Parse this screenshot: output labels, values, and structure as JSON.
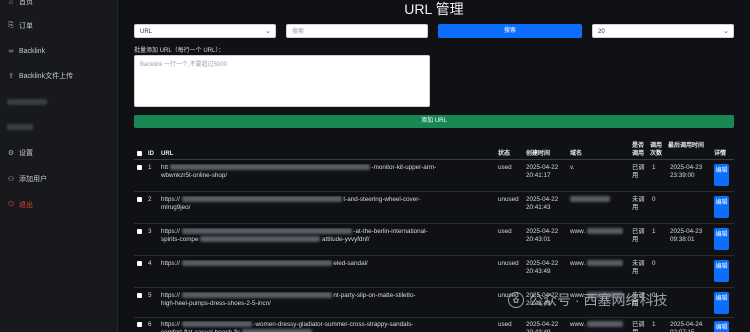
{
  "sidebar": {
    "items": [
      {
        "label": "首页",
        "icon": "home-icon",
        "glyph": "⌂"
      },
      {
        "label": "订单",
        "icon": "order-icon",
        "glyph": "⎘"
      },
      {
        "label": "Backlink",
        "icon": "link-icon",
        "glyph": "∞"
      },
      {
        "label": "Backlink文件上传",
        "icon": "upload-icon",
        "glyph": "⇪"
      },
      {
        "label": "设置",
        "icon": "gear-icon",
        "glyph": "⚙"
      },
      {
        "label": "添加用户",
        "icon": "user-add-icon",
        "glyph": "⚇"
      },
      {
        "label": "退出",
        "icon": "logout-icon",
        "glyph": "⏻"
      }
    ]
  },
  "header": {
    "title": "URL 管理"
  },
  "filters": {
    "field_select": "URL",
    "search_placeholder": "搜索",
    "search_button": "搜索",
    "page_size": "20"
  },
  "batch": {
    "label": "批量添加 URL（每行一个 URL）：",
    "placeholder": "Backlink 一行一个,不要超过5000",
    "add_button": "添加 URL"
  },
  "table": {
    "headers": {
      "id": "ID",
      "url": "URL",
      "status": "状态",
      "created": "创建时间",
      "domain": "域名",
      "called": "是否调用",
      "count": "调用次数",
      "last_called": "最后调用时间",
      "detail": "详情"
    },
    "rows": [
      {
        "id": "1",
        "url1": "htt",
        "url1b": "-monitor-kit-upper-arm-",
        "url2": "wbwnkzr5t-online-shop/",
        "status": "used",
        "created": "2025-04-22 20:41:17",
        "domain": "v.",
        "called": "已调用",
        "count": "1",
        "last": "2025-04-23 23:39:00",
        "edit": "编辑"
      },
      {
        "id": "2",
        "url1": "https://",
        "url1b": "t-and-steering-wheel-cover-",
        "url2": "mlrug9jeo/",
        "status": "unused",
        "created": "2025-04-22 20:41:43",
        "domain": "",
        "called": "未调用",
        "count": "0",
        "last": "",
        "edit": "编辑"
      },
      {
        "id": "3",
        "url1": "https://",
        "url1b": "-at-the-berlin-international-",
        "url2": "spirits-compe",
        "url2b": "attitude-yvvyfdnf/",
        "status": "used",
        "created": "2025-04-22 20:43:01",
        "domain": "www.",
        "called": "已调用",
        "count": "1",
        "last": "2025-04-23 09:38:01",
        "edit": "编辑"
      },
      {
        "id": "4",
        "url1": "https://",
        "url1b": "eled-sandal/",
        "url2": "",
        "status": "unused",
        "created": "2025-04-22 20:43:49",
        "domain": "www.",
        "called": "未调用",
        "count": "0",
        "last": "",
        "edit": "编辑"
      },
      {
        "id": "5",
        "url1": "https://",
        "url1b": "nt-party-slip-on-matte-stiletto-",
        "url2": "high-heel-pumps-dress-shoes-2-5-incn/",
        "status": "unused",
        "created": "2025-04-22 20:43:49",
        "domain": "www.",
        "called": "未调用",
        "count": "0",
        "last": "",
        "edit": "编辑"
      },
      {
        "id": "6",
        "url1": "https://",
        "url1b": "-women-dressy-gladiator-summer-cross-strappy-sandals-",
        "url2": "comfort-flat-casual-beach-fis",
        "status": "used",
        "created": "2025-04-22 20:43:49",
        "domain": "www.",
        "called": "已调用",
        "count": "1",
        "last": "2025-04-24 02:07:15",
        "edit": "编辑"
      }
    ]
  },
  "watermark": {
    "text": "公众号 · 西塞网络科技"
  }
}
